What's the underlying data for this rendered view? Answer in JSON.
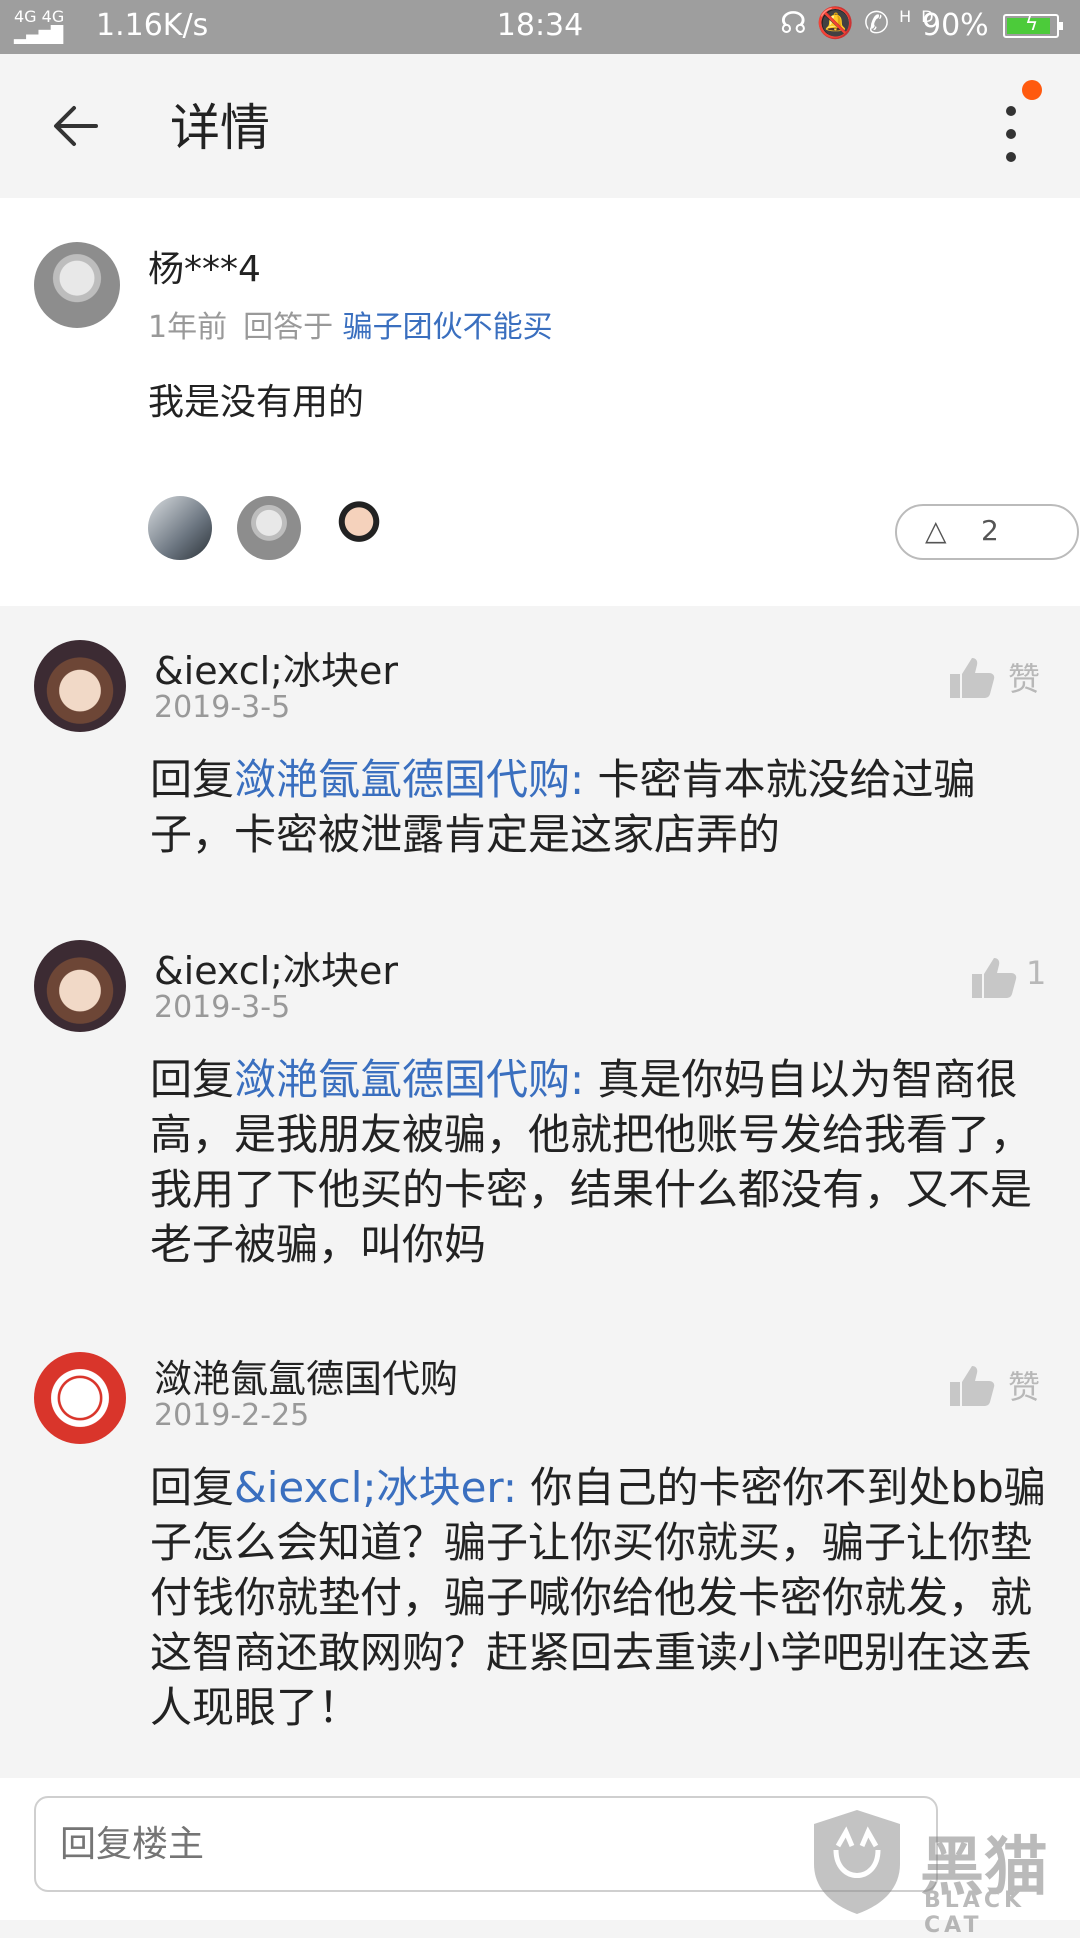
{
  "status_bar": {
    "signal": "4G 4G",
    "speed": "1.16K/s",
    "time": "18:34",
    "icons": [
      "headset-icon",
      "bell-muted-icon",
      "hd-call-icon"
    ],
    "hd_label": "HD",
    "battery": "90%",
    "battery_level": 0.9,
    "battery_color": "#4ccb3a"
  },
  "header": {
    "title": "详情",
    "back_icon": "arrow-left-icon",
    "menu_icon": "more-vertical-icon",
    "badge_color": "#ff5a0f"
  },
  "post": {
    "author": "杨***4",
    "time_ago": "1年前",
    "reply_prefix": "回答于",
    "reply_target": "骗子团伙不能买",
    "content": "我是没有用的",
    "like_count": "2"
  },
  "comments": [
    {
      "name": "&iexcl;冰块er",
      "date": "2019-3-5",
      "reply_prefix": "回复",
      "reply_to": "潋滟氤氲德国代购:",
      "text": " 卡密肯本就没给过骗子，卡密被泄露肯定是这家店弄的",
      "like_label": "赞"
    },
    {
      "name": "&iexcl;冰块er",
      "date": "2019-3-5",
      "reply_prefix": "回复",
      "reply_to": "潋滟氤氲德国代购:",
      "text": " 真是你妈自以为智商很高，是我朋友被骗，他就把他账号发给我看了，我用了下他买的卡密，结果什么都没有，又不是老子被骗，叫你妈",
      "like_label": "1"
    },
    {
      "name": "潋滟氤氲德国代购",
      "date": "2019-2-25",
      "reply_prefix": "回复",
      "reply_to": "&iexcl;冰块er:",
      "text": " 你自己的卡密你不到处bb骗子怎么会知道？骗子让你买你就买，骗子让你垫付钱你就垫付，骗子喊你给他发卡密你就发，就这智商还敢网购？赶紧回去重读小学吧别在这丢人现眼了！",
      "like_label": "赞"
    }
  ],
  "reply_bar": {
    "placeholder": "回复楼主"
  },
  "watermark": {
    "title": "黑猫",
    "subtitle": "BLACK CAT"
  },
  "colors": {
    "link": "#3a6fbf",
    "status_bar_bg": "#9e9e9e"
  }
}
